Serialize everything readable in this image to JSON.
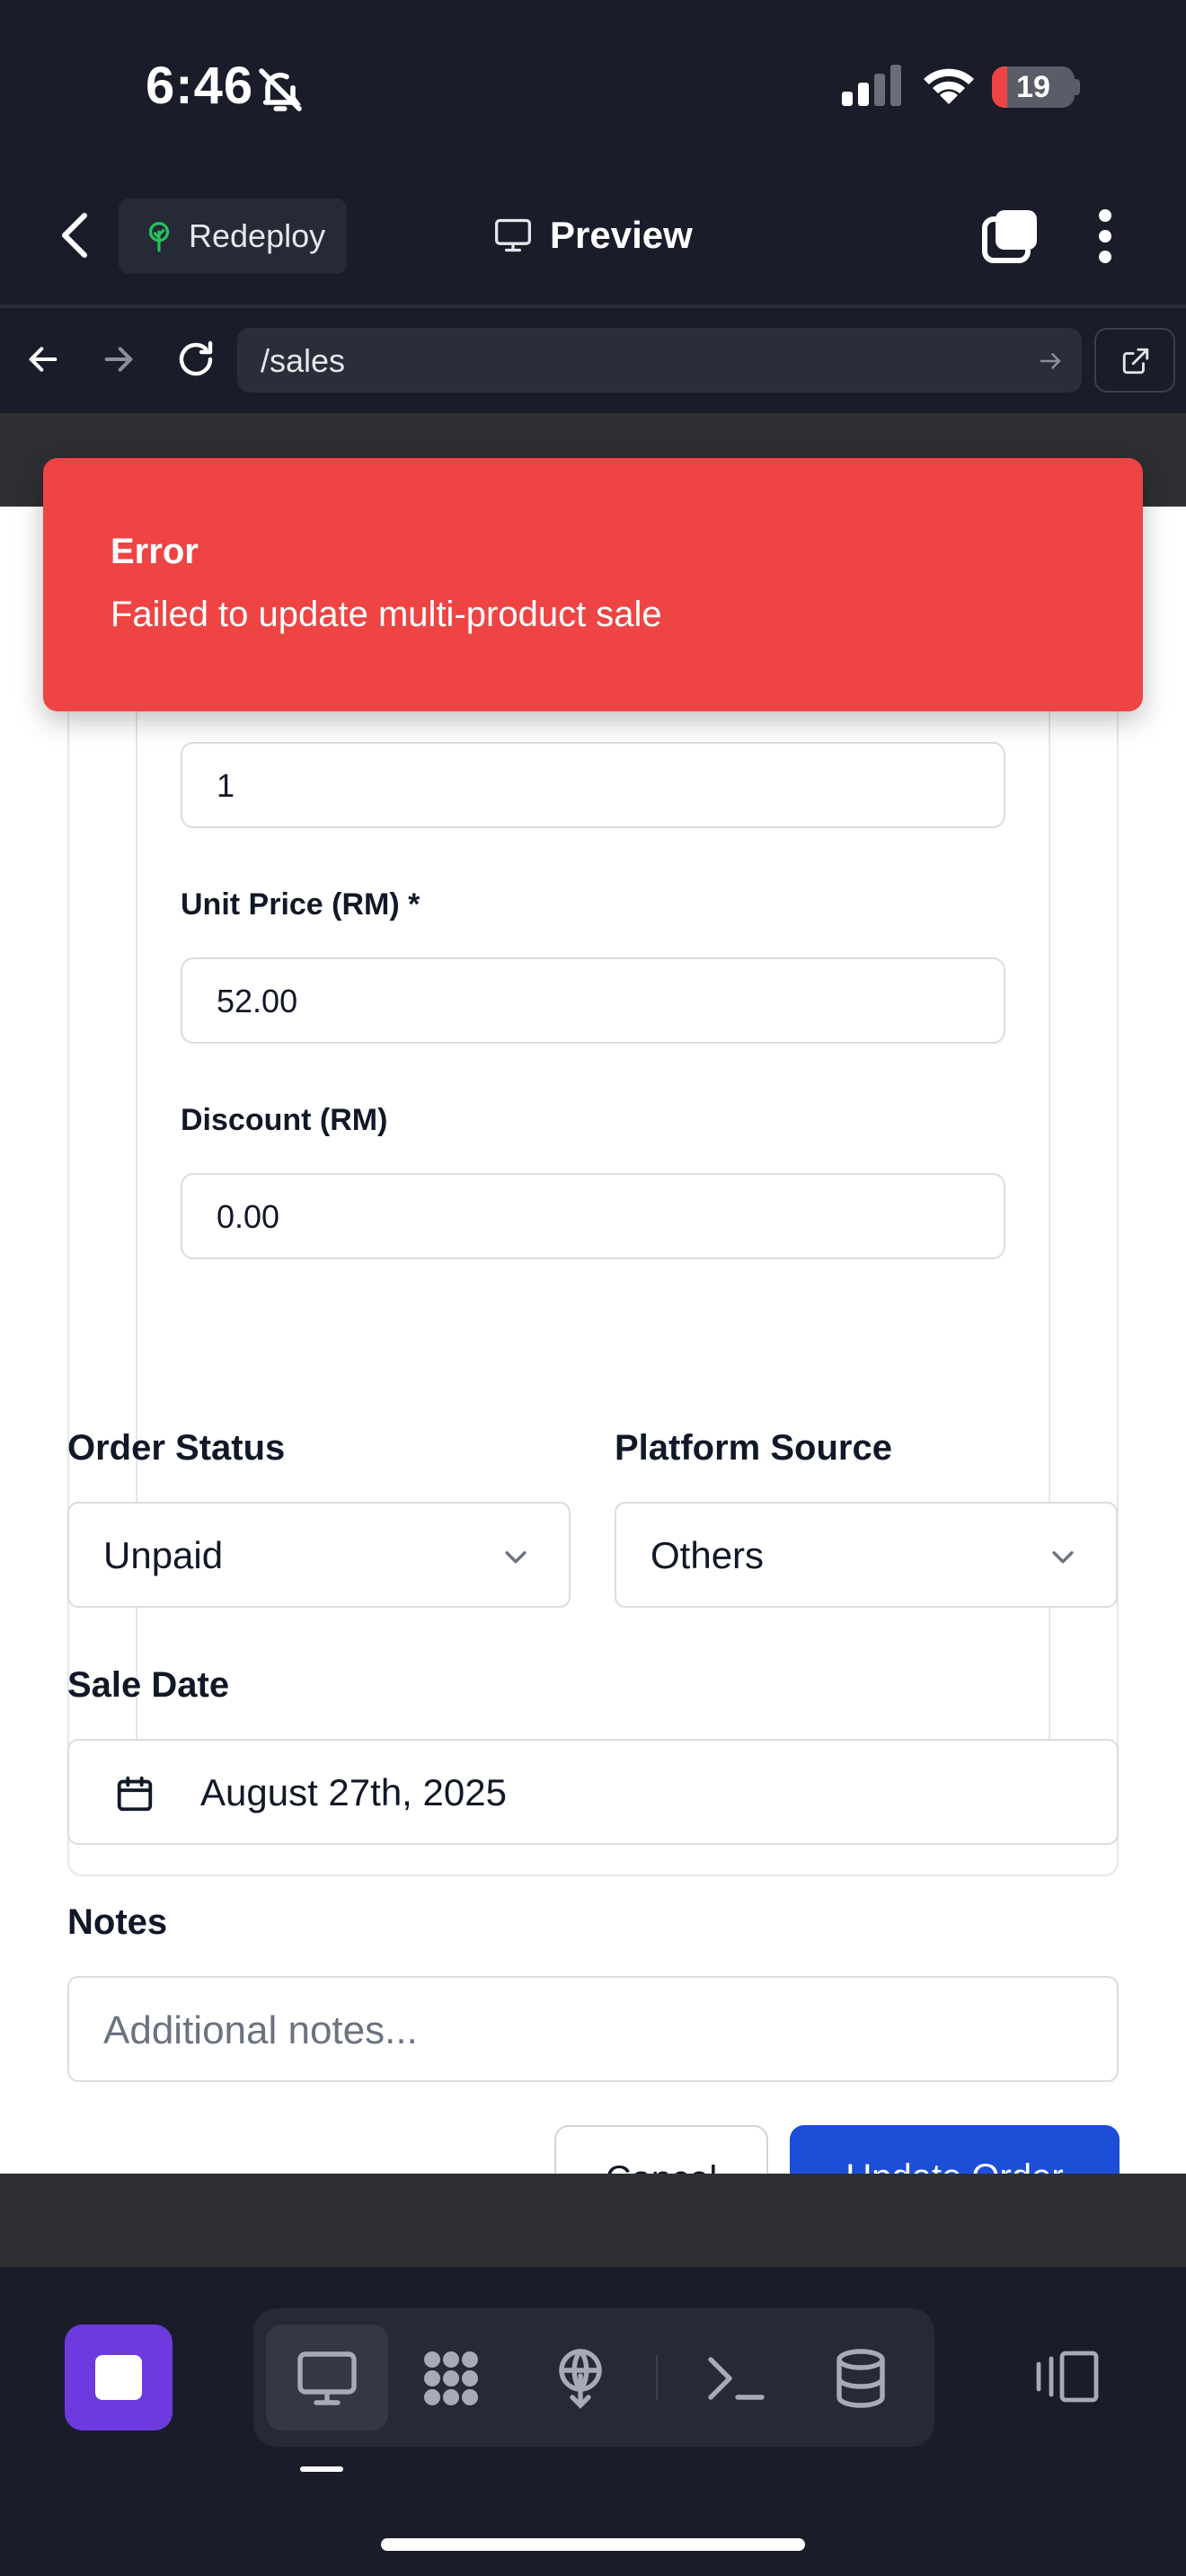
{
  "status_bar": {
    "time": "6:46",
    "battery": "19",
    "battery_level": 0.19
  },
  "header": {
    "redeploy_label": "Redeploy",
    "preview_label": "Preview"
  },
  "browser": {
    "url": "/sales"
  },
  "toast": {
    "title": "Error",
    "message": "Failed to update multi-product sale"
  },
  "form": {
    "quantity_value": "1",
    "unit_price_label": "Unit Price (RM) *",
    "unit_price_value": "52.00",
    "discount_label": "Discount (RM)",
    "discount_value": "0.00",
    "order_status_label": "Order Status",
    "order_status_value": "Unpaid",
    "platform_source_label": "Platform Source",
    "platform_source_value": "Others",
    "sale_date_label": "Sale Date",
    "sale_date_value": "August 27th, 2025",
    "notes_label": "Notes",
    "notes_placeholder": "Additional notes...",
    "cancel_label": "Cancel",
    "update_label": "Update Order"
  },
  "colors": {
    "error": "#ef4444",
    "primary": "#1d4ed8",
    "accent": "#6d3ae0",
    "background": "#1a1d29"
  }
}
